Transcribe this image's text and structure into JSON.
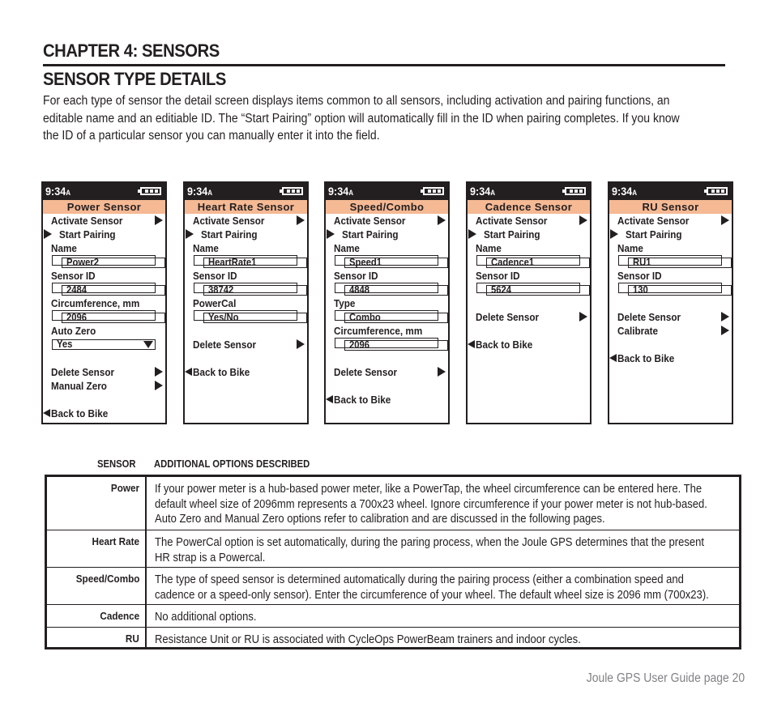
{
  "chapter_title": "CHAPTER 4: SENSORS",
  "section_title": "SENSOR TYPE DETAILS",
  "intro_lines": [
    "For each type of sensor the detail screen displays items common to all sensors, including activation and pairing functions, an",
    "editable name and an editiable ID.  The “Start Pairing” option will automatically fill in the ID when pairing completes. If you know",
    "the ID of a particular sensor you can manually enter it into the field."
  ],
  "colors": {
    "text": "#231f20",
    "device_title_bg": "#f5b994",
    "footer_text": "#808285"
  },
  "screens": [
    {
      "time": "9:34",
      "ampm": "A",
      "title": "Power Sensor",
      "rows": [
        {
          "type": "action",
          "label": "Activate Sensor"
        },
        {
          "type": "pair",
          "label": "Start Pairing"
        },
        {
          "type": "label",
          "label": "Name"
        },
        {
          "type": "field",
          "value": "Power2"
        },
        {
          "type": "label",
          "label": "Sensor ID"
        },
        {
          "type": "field",
          "value": "2484"
        },
        {
          "type": "label",
          "label": "Circumference, mm"
        },
        {
          "type": "field",
          "value": "2096"
        },
        {
          "type": "label",
          "label": "Auto Zero"
        },
        {
          "type": "dropdown",
          "value": "Yes"
        },
        {
          "type": "blank"
        },
        {
          "type": "action",
          "label": "Delete Sensor"
        },
        {
          "type": "action",
          "label": "Manual Zero"
        },
        {
          "type": "blank"
        },
        {
          "type": "back",
          "label": "Back to Bike"
        }
      ]
    },
    {
      "time": "9:34",
      "ampm": "A",
      "title": "Heart Rate Sensor",
      "rows": [
        {
          "type": "action",
          "label": "Activate Sensor"
        },
        {
          "type": "pair",
          "label": "Start Pairing"
        },
        {
          "type": "label",
          "label": "Name"
        },
        {
          "type": "field",
          "value": "HeartRate1"
        },
        {
          "type": "label",
          "label": "Sensor ID"
        },
        {
          "type": "field",
          "value": "38742"
        },
        {
          "type": "label",
          "label": "PowerCal"
        },
        {
          "type": "field",
          "value": "Yes/No"
        },
        {
          "type": "blank"
        },
        {
          "type": "action",
          "label": "Delete Sensor"
        },
        {
          "type": "blank"
        },
        {
          "type": "back",
          "label": "Back to Bike"
        }
      ]
    },
    {
      "time": "9:34",
      "ampm": "A",
      "title": "Speed/Combo",
      "rows": [
        {
          "type": "action",
          "label": "Activate Sensor"
        },
        {
          "type": "pair",
          "label": "Start Pairing"
        },
        {
          "type": "label",
          "label": "Name"
        },
        {
          "type": "field",
          "value": "Speed1"
        },
        {
          "type": "label",
          "label": "Sensor ID"
        },
        {
          "type": "field",
          "value": "4848"
        },
        {
          "type": "label",
          "label": "Type"
        },
        {
          "type": "field",
          "value": "Combo"
        },
        {
          "type": "label",
          "label": "Circumference, mm"
        },
        {
          "type": "field",
          "value": "2096"
        },
        {
          "type": "blank"
        },
        {
          "type": "action",
          "label": "Delete Sensor"
        },
        {
          "type": "blank"
        },
        {
          "type": "back",
          "label": "Back to Bike"
        }
      ]
    },
    {
      "time": "9:34",
      "ampm": "A",
      "title": "Cadence Sensor",
      "rows": [
        {
          "type": "action",
          "label": "Activate Sensor"
        },
        {
          "type": "pair",
          "label": "Start Pairing"
        },
        {
          "type": "label",
          "label": "Name"
        },
        {
          "type": "field",
          "value": "Cadence1"
        },
        {
          "type": "label",
          "label": "Sensor ID"
        },
        {
          "type": "field",
          "value": "5624"
        },
        {
          "type": "blank"
        },
        {
          "type": "action",
          "label": "Delete Sensor"
        },
        {
          "type": "blank"
        },
        {
          "type": "back",
          "label": "Back to Bike"
        }
      ]
    },
    {
      "time": "9:34",
      "ampm": "A",
      "title": "RU Sensor",
      "rows": [
        {
          "type": "action",
          "label": "Activate Sensor"
        },
        {
          "type": "pair",
          "label": "Start Pairing"
        },
        {
          "type": "label",
          "label": "Name"
        },
        {
          "type": "field",
          "value": "RU1"
        },
        {
          "type": "label",
          "label": "Sensor ID"
        },
        {
          "type": "field",
          "value": "130"
        },
        {
          "type": "blank"
        },
        {
          "type": "action",
          "label": "Delete Sensor"
        },
        {
          "type": "action",
          "label": "Calibrate"
        },
        {
          "type": "blank"
        },
        {
          "type": "back",
          "label": "Back to Bike"
        }
      ]
    }
  ],
  "options_table": {
    "headers": {
      "sensor": "SENSOR",
      "description": "ADDITIONAL OPTIONS DESCRIBED"
    },
    "rows": [
      {
        "sensor": "Power",
        "lines": [
          "If your power meter is a hub-based power meter, like a PowerTap, the wheel circumference can be entered here. The",
          "default wheel size of 2096mm represents a 700x23 wheel. Ignore circumference if your power meter is not hub-based.",
          "Auto Zero and Manual Zero options refer to calibration and are discussed in the following pages."
        ]
      },
      {
        "sensor": "Heart Rate",
        "lines": [
          "The PowerCal option is set automatically, during the paring process, when the Joule GPS determines that the present",
          "HR strap is a Powercal."
        ]
      },
      {
        "sensor": "Speed/Combo",
        "lines": [
          "The type of speed sensor is determined automatically during the pairing process (either a combination speed and",
          "cadence or a speed-only sensor). Enter the circumference of your wheel. The default wheel size is 2096 mm (700x23)."
        ]
      },
      {
        "sensor": "Cadence",
        "lines": [
          "No additional options."
        ]
      },
      {
        "sensor": "RU",
        "lines": [
          "Resistance Unit  or RU is associated with CycleOps PowerBeam trainers and indoor cycles."
        ]
      }
    ]
  },
  "footer": "Joule GPS User Guide page 20"
}
